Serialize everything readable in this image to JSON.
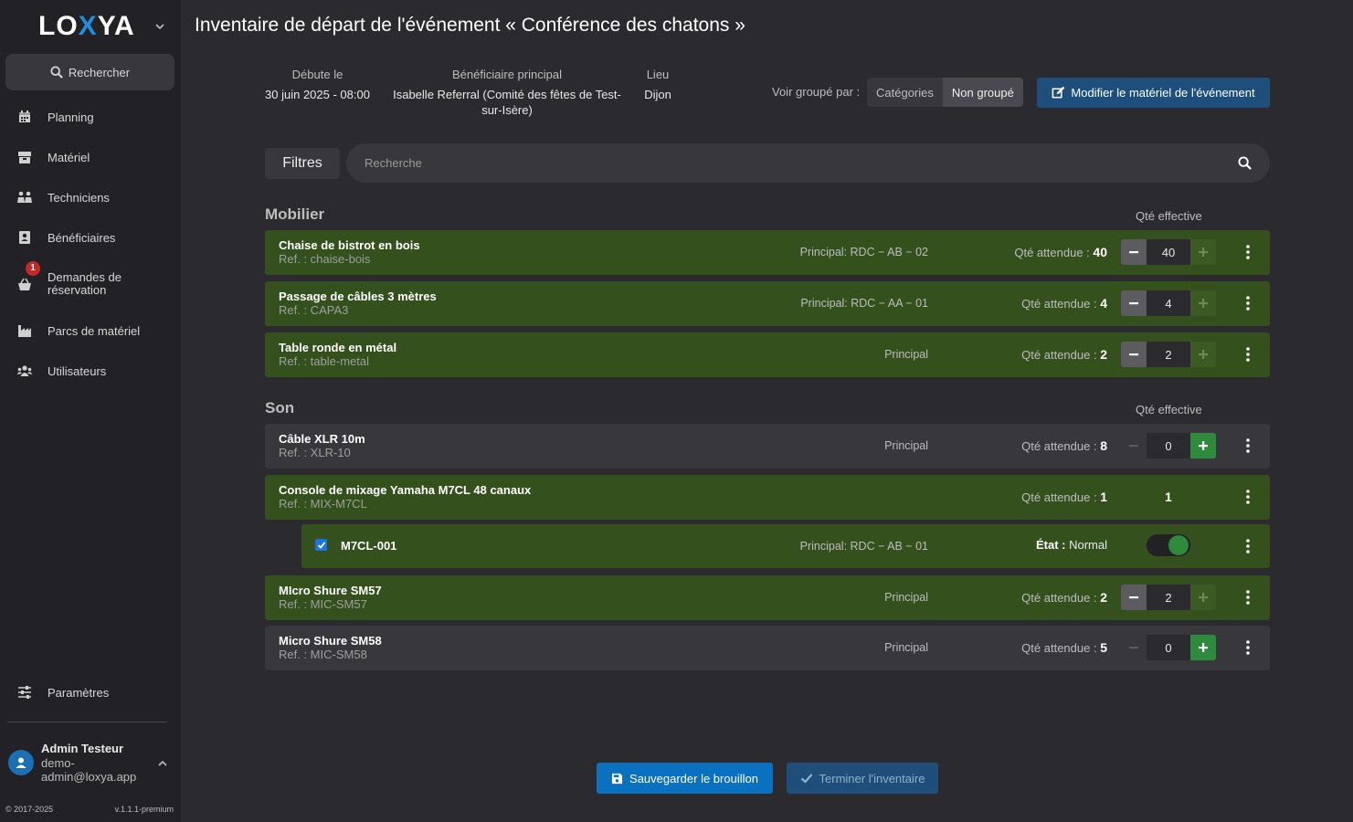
{
  "app": {
    "logo_left": "LO",
    "logo_x": "X",
    "logo_right": "YA",
    "page_title": "Inventaire de départ de l'événement « Conférence des chatons »"
  },
  "sidebar": {
    "search_label": "Rechercher",
    "items": [
      {
        "label": "Planning",
        "icon": "calendar-icon"
      },
      {
        "label": "Matériel",
        "icon": "box-icon"
      },
      {
        "label": "Techniciens",
        "icon": "people-icon"
      },
      {
        "label": "Bénéficiaires",
        "icon": "address-book-icon"
      },
      {
        "label": "Demandes de réservation",
        "icon": "basket-icon",
        "badge": "1"
      },
      {
        "label": "Parcs de matériel",
        "icon": "industry-icon"
      },
      {
        "label": "Utilisateurs",
        "icon": "users-icon"
      }
    ],
    "settings_label": "Paramètres",
    "user": {
      "name": "Admin Testeur",
      "email": "demo-admin@loxya.app"
    },
    "footer": {
      "copyright": "© 2017-2025",
      "version": "v.1.1.1-premium"
    }
  },
  "info": {
    "start_label": "Débute le",
    "start_value": "30 juin 2025 - 08:00",
    "beneficiary_label": "Bénéficiaire principal",
    "beneficiary_value": "Isabelle Referral (Comité des fêtes de Test-sur-Isère)",
    "location_label": "Lieu",
    "location_value": "Dijon",
    "group_label": "Voir groupé par :",
    "group_options": [
      "Catégories",
      "Non groupé"
    ],
    "edit_button": "Modifier le matériel de l'événement"
  },
  "filters": {
    "button": "Filtres",
    "search_placeholder": "Recherche"
  },
  "sections": [
    {
      "title": "Mobilier",
      "qty_header": "Qté effective",
      "items": [
        {
          "name": "Chaise de bistrot en bois",
          "ref": "Ref. : chaise-bois",
          "location": "Principal: RDC − AB − 02",
          "expected_label": "Qté attendue :",
          "expected": "40",
          "value": "40"
        },
        {
          "name": "Passage de câbles 3 mètres",
          "ref": "Ref. : CAPA3",
          "location": "Principal: RDC − AA − 01",
          "expected_label": "Qté attendue :",
          "expected": "4",
          "value": "4"
        },
        {
          "name": "Table ronde en métal",
          "ref": "Ref. : table-metal",
          "location": "Principal",
          "expected_label": "Qté attendue :",
          "expected": "2",
          "value": "2"
        }
      ]
    },
    {
      "title": "Son",
      "qty_header": "Qté effective",
      "items": [
        {
          "name": "Câble XLR 10m",
          "ref": "Ref. : XLR-10",
          "location": "Principal",
          "expected_label": "Qté attendue :",
          "expected": "8",
          "value": "0"
        },
        {
          "name": "Console de mixage Yamaha M7CL 48 canaux",
          "ref": "Ref. : MIX-M7CL",
          "location": "",
          "expected_label": "Qté attendue :",
          "expected": "1",
          "value": "1"
        },
        {
          "name": "MIcro Shure SM57",
          "ref": "Ref. : MIC-SM57",
          "location": "Principal",
          "expected_label": "Qté attendue :",
          "expected": "2",
          "value": "2"
        },
        {
          "name": "Micro Shure SM58",
          "ref": "Ref. : MIC-SM58",
          "location": "Principal",
          "expected_label": "Qté attendue :",
          "expected": "5",
          "value": "0"
        }
      ],
      "unit": {
        "id": "M7CL-001",
        "location": "Principal: RDC − AB − 01",
        "state_label": "État :",
        "state_value": "Normal"
      }
    }
  ],
  "actions": {
    "save": "Sauvegarder le brouillon",
    "finish": "Terminer l'inventaire"
  },
  "colors": {
    "ok_row": "#34501d",
    "pending_row": "#38373c",
    "primary": "#0a70c0",
    "success": "#2e8b3c",
    "badge": "#c62828"
  }
}
